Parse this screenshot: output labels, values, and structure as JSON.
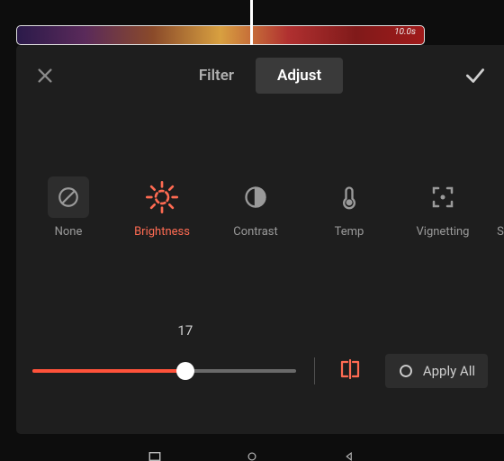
{
  "timeline": {
    "clip_duration_label": "10.0s"
  },
  "header": {
    "tabs": {
      "filter": "Filter",
      "adjust": "Adjust"
    }
  },
  "adjust": {
    "items": [
      {
        "key": "none",
        "label": "None"
      },
      {
        "key": "brightness",
        "label": "Brightness"
      },
      {
        "key": "contrast",
        "label": "Contrast"
      },
      {
        "key": "temp",
        "label": "Temp"
      },
      {
        "key": "vignetting",
        "label": "Vignetting"
      },
      {
        "key": "saturation",
        "label": "Saturtio"
      }
    ],
    "active_key": "brightness"
  },
  "slider": {
    "value": 17,
    "value_label": "17",
    "percent": 58
  },
  "actions": {
    "apply_all_label": "Apply All"
  },
  "colors": {
    "accent": "#ff6b52"
  }
}
